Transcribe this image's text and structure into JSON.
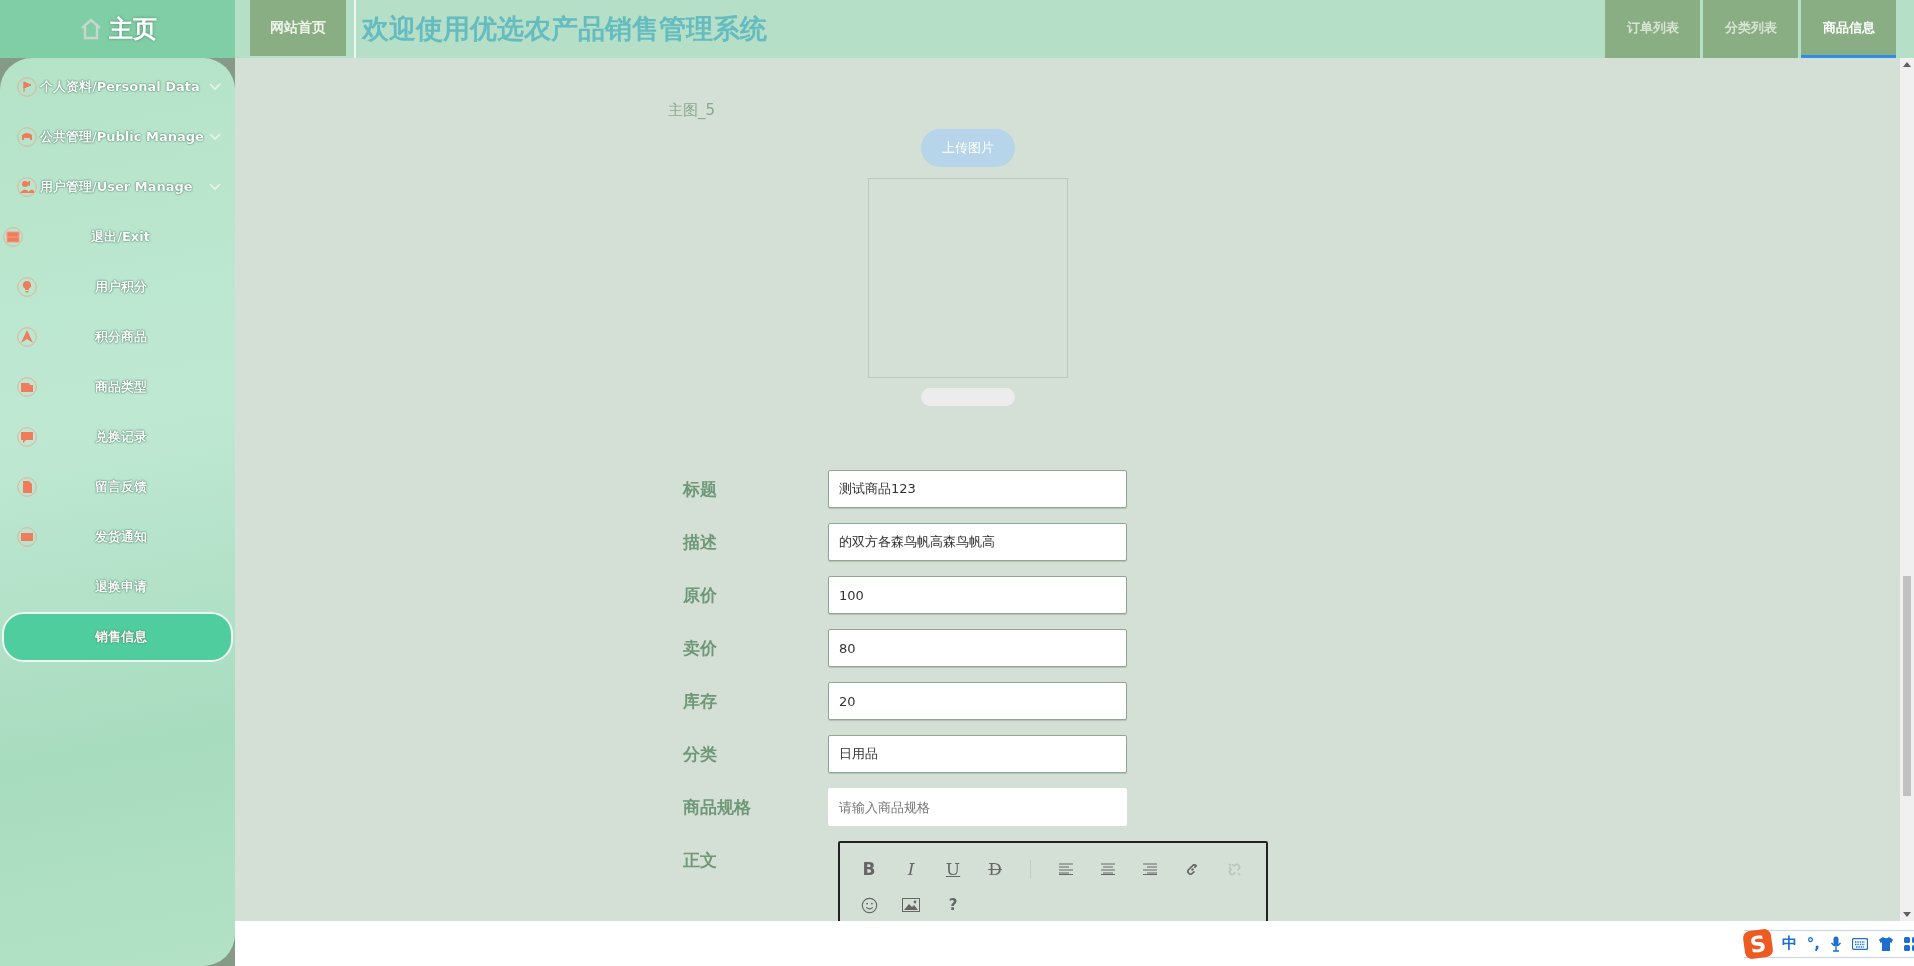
{
  "sidebar": {
    "home": "主页",
    "items": [
      {
        "label": "个人资料/Personal Data",
        "kind": "group",
        "selected": false
      },
      {
        "label": "公共管理/Public Manage",
        "kind": "group",
        "selected": false
      },
      {
        "label": "用户管理/User Manage",
        "kind": "group",
        "selected": false
      },
      {
        "label": "退出/Exit",
        "kind": "link",
        "selected": false
      },
      {
        "label": "用户积分",
        "kind": "link",
        "selected": false
      },
      {
        "label": "积分商品",
        "kind": "link",
        "selected": false
      },
      {
        "label": "商品类型",
        "kind": "link",
        "selected": false
      },
      {
        "label": "兑换记录",
        "kind": "link",
        "selected": false
      },
      {
        "label": "留言反馈",
        "kind": "link",
        "selected": false
      },
      {
        "label": "发货通知",
        "kind": "link",
        "selected": false
      },
      {
        "label": "退换申请",
        "kind": "link",
        "selected": false
      },
      {
        "label": "销售信息",
        "kind": "link",
        "selected": true
      }
    ]
  },
  "header": {
    "home_button": "网站首页",
    "title": "欢迎使用优选农产品销售管理系统",
    "tabs": [
      {
        "label": "订单列表",
        "selected": false
      },
      {
        "label": "分类列表",
        "selected": false
      },
      {
        "label": "商品信息",
        "selected": true
      }
    ]
  },
  "image_upload": {
    "label": "主图_5",
    "button": "上传图片"
  },
  "form": {
    "fields": [
      {
        "label": "标题",
        "value": "测试商品123"
      },
      {
        "label": "描述",
        "value": "的双方各森鸟帆高森鸟帆高"
      },
      {
        "label": "原价",
        "value": "100"
      },
      {
        "label": "卖价",
        "value": "80"
      },
      {
        "label": "库存",
        "value": "20"
      },
      {
        "label": "分类",
        "value": "日用品"
      },
      {
        "label": "商品规格",
        "placeholder": "请输入商品规格"
      }
    ],
    "body_label": "正文",
    "toolbar": [
      {
        "kind": "bold",
        "label": "B",
        "disabled": false
      },
      {
        "kind": "italic",
        "label": "I",
        "disabled": false
      },
      {
        "kind": "underline",
        "label": "U",
        "disabled": false
      },
      {
        "kind": "strike",
        "label": "D",
        "disabled": false
      },
      {
        "kind": "separator"
      },
      {
        "kind": "align-left",
        "disabled": false
      },
      {
        "kind": "align-center",
        "disabled": false
      },
      {
        "kind": "align-right",
        "disabled": false
      },
      {
        "kind": "link",
        "disabled": false
      },
      {
        "kind": "unlink",
        "disabled": true
      },
      {
        "kind": "break"
      },
      {
        "kind": "emoji",
        "disabled": false
      },
      {
        "kind": "image",
        "disabled": false
      },
      {
        "kind": "help",
        "label": "?",
        "disabled": false
      }
    ]
  },
  "ime_bar": {
    "logo": "S",
    "mode": "中",
    "punctuation": "°,"
  }
}
